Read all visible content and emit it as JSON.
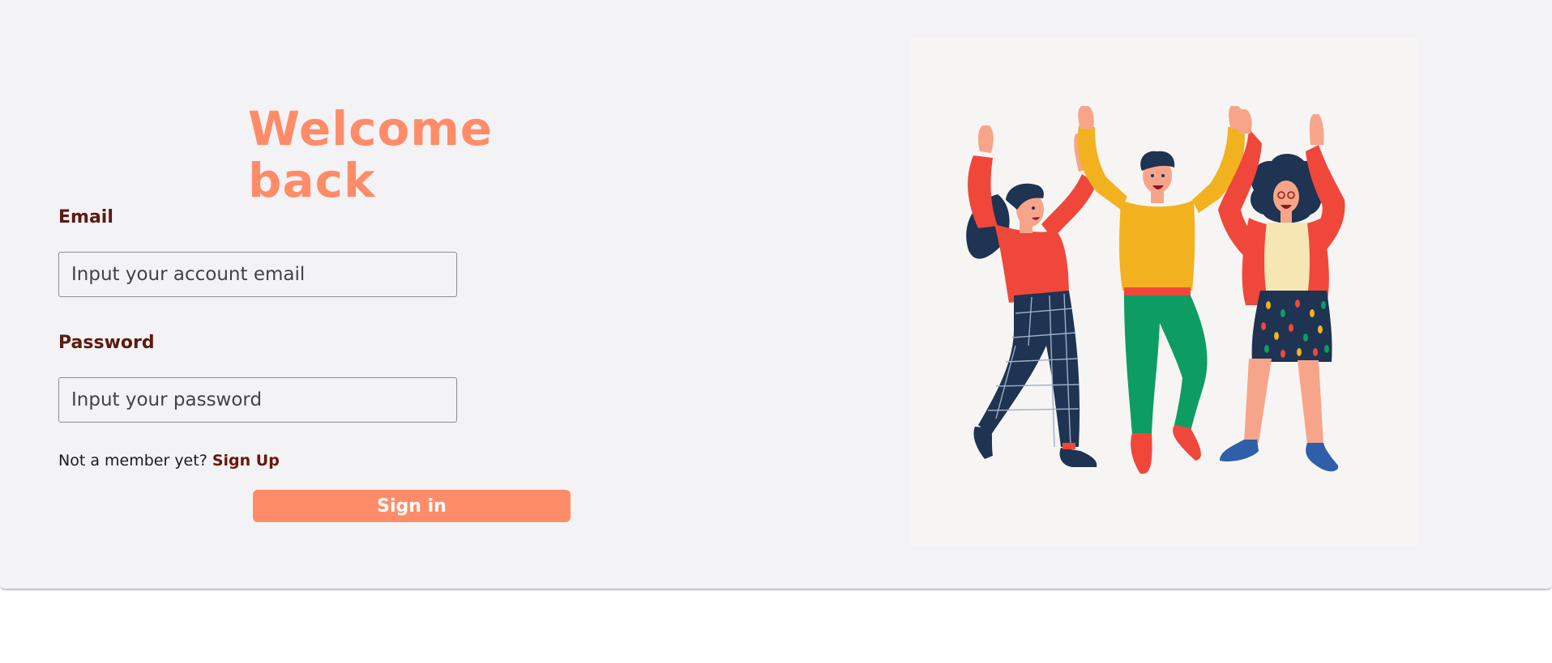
{
  "login": {
    "title": "Welcome back",
    "email_label": "Email",
    "email_placeholder": "Input your account email",
    "email_value": "",
    "password_label": "Password",
    "password_placeholder": "Input your password",
    "password_value": "",
    "member_prompt": "Not a member yet?",
    "signup_link": "Sign Up",
    "signin_button": "Sign in"
  },
  "colors": {
    "accent": "#ff8c68",
    "label": "#5c1a0e",
    "card_bg": "#f3f2f5"
  }
}
